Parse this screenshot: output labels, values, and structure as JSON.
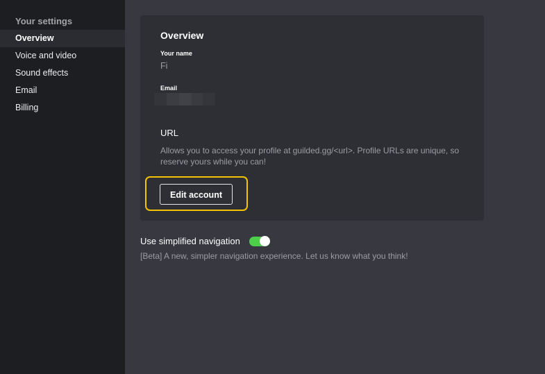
{
  "sidebar": {
    "heading": "Your settings",
    "items": [
      {
        "label": "Overview",
        "active": true
      },
      {
        "label": "Voice and video",
        "active": false
      },
      {
        "label": "Sound effects",
        "active": false
      },
      {
        "label": "Email",
        "active": false
      },
      {
        "label": "Billing",
        "active": false
      }
    ]
  },
  "overview": {
    "title": "Overview",
    "name_label": "Your name",
    "name_value": "Fi",
    "email_label": "Email",
    "url_title": "URL",
    "url_description": "Allows you to access your profile at guilded.gg/<url>. Profile URLs are unique, so reserve yours while you can!",
    "edit_button": "Edit account"
  },
  "simplified_navigation": {
    "label": "Use simplified navigation",
    "enabled": true,
    "description": "[Beta] A new, simpler navigation experience. Let us know what you think!"
  },
  "colors": {
    "sidebar_bg": "#1d1e22",
    "main_bg": "#373840",
    "card_bg": "#2e2f35",
    "highlight": "#f5c400",
    "toggle_on": "#4dcf4a"
  }
}
